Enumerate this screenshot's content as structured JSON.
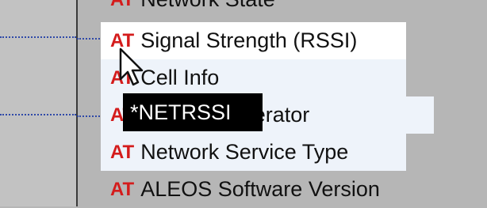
{
  "rows": [
    {
      "at": "AT",
      "label": "Network State"
    },
    {
      "at": "AT",
      "label": "Signal Strength (RSSI)"
    },
    {
      "at": "AT",
      "label": "Cell Info"
    },
    {
      "at": "AT",
      "label": "Network Operator"
    },
    {
      "at": "AT",
      "label": "Network Service Type"
    },
    {
      "at": "AT",
      "label": "ALEOS Software Version"
    }
  ],
  "tooltip": {
    "text": "*NETRSSI"
  },
  "colors": {
    "at_badge": "#d41c1c",
    "tree_line": "#2f49a8",
    "tooltip_bg": "#000000"
  },
  "icons": {
    "cursor": "mouse-pointer-icon"
  }
}
